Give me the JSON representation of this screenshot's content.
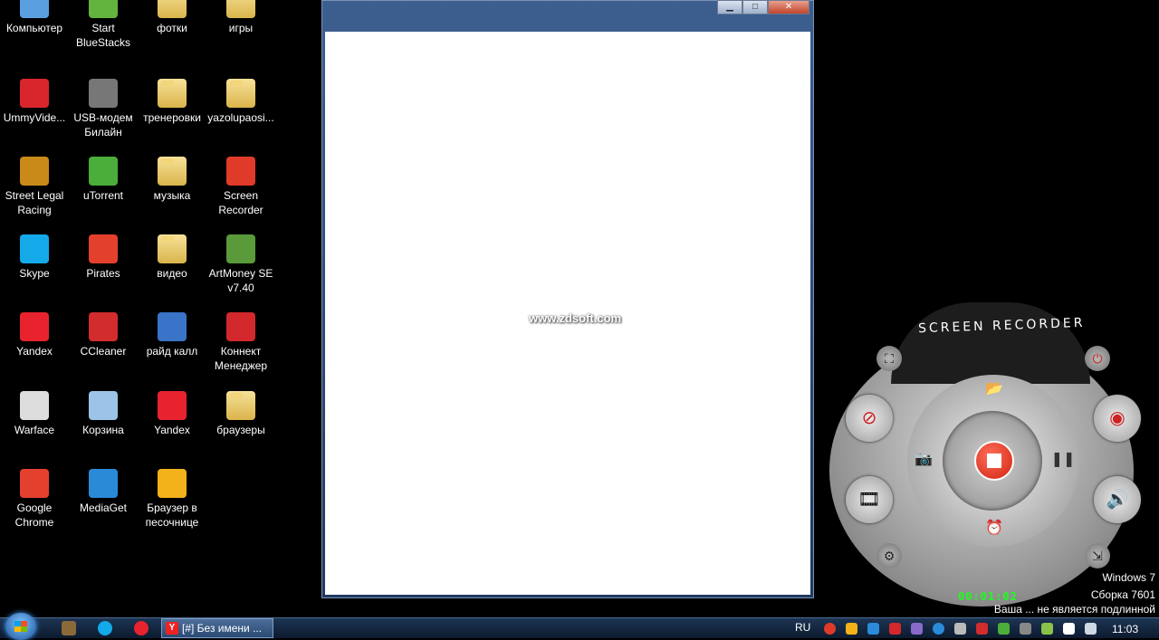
{
  "desktop_icons": [
    {
      "label": "Компьютер",
      "icon": "computer-icon",
      "color": "#5aa0e0"
    },
    {
      "label": "Start\nBlueStacks",
      "icon": "bluestacks-icon",
      "color": "#63b33f"
    },
    {
      "label": "фотки",
      "icon": "folder-icon",
      "color": "#e8c55b"
    },
    {
      "label": "игры",
      "icon": "folder-icon",
      "color": "#e8c55b"
    },
    {
      "label": "UmmyVide...",
      "icon": "ummy-icon",
      "color": "#d9262c"
    },
    {
      "label": "USB-модем\nБилайн",
      "icon": "usb-modem-icon",
      "color": "#777777"
    },
    {
      "label": "тренеровки",
      "icon": "folder-icon",
      "color": "#e8c55b"
    },
    {
      "label": "yazolupaosi...",
      "icon": "folder-icon",
      "color": "#e8c55b"
    },
    {
      "label": "Street Legal\nRacing",
      "icon": "racing-icon",
      "color": "#c98a1a"
    },
    {
      "label": "uTorrent",
      "icon": "utorrent-icon",
      "color": "#4cae3a"
    },
    {
      "label": "музыка",
      "icon": "folder-icon",
      "color": "#e8c55b"
    },
    {
      "label": "Screen\nRecorder",
      "icon": "screen-recorder-icon",
      "color": "#e03a2a"
    },
    {
      "label": "Skype",
      "icon": "skype-icon",
      "color": "#14a9e8"
    },
    {
      "label": "Pirates",
      "icon": "chrome-icon",
      "color": "#e4402e"
    },
    {
      "label": "видео",
      "icon": "folder-icon",
      "color": "#e8c55b"
    },
    {
      "label": "ArtMoney SE\nv7.40",
      "icon": "artmoney-icon",
      "color": "#5a9a3a"
    },
    {
      "label": "Yandex",
      "icon": "yandex-icon",
      "color": "#e8232e"
    },
    {
      "label": "CCleaner",
      "icon": "ccleaner-icon",
      "color": "#d22c2c"
    },
    {
      "label": "райд калл",
      "icon": "raidcall-icon",
      "color": "#3a74c8"
    },
    {
      "label": "Коннект\nМенеджер",
      "icon": "connect-manager-icon",
      "color": "#d3282c"
    },
    {
      "label": "Warface",
      "icon": "warface-icon",
      "color": "#dddddd"
    },
    {
      "label": "Корзина",
      "icon": "recycle-bin-icon",
      "color": "#9cc4e8"
    },
    {
      "label": "Yandex",
      "icon": "yandex-icon",
      "color": "#e8232e"
    },
    {
      "label": "браузеры",
      "icon": "folder-icon",
      "color": "#e8c55b"
    },
    {
      "label": "Google\nChrome",
      "icon": "chrome-icon",
      "color": "#e4402e"
    },
    {
      "label": "MediaGet",
      "icon": "mediaget-icon",
      "color": "#2a8ad8"
    },
    {
      "label": "Браузер в\nпесочнице",
      "icon": "sandbox-browser-icon",
      "color": "#f3b21a"
    }
  ],
  "window": {
    "minimize": "▁",
    "maximize": "□",
    "close": "✕"
  },
  "watermark": "www.zdsoft.com",
  "recorder": {
    "title": "SCREEN RECORDER",
    "timer": "00:01:02"
  },
  "os_notice": {
    "line1": "Windows 7",
    "line2": "Сборка 7601",
    "line3": "Ваша ... не является подлинной"
  },
  "taskbar": {
    "task_label": "[#] Без имени ...",
    "language": "RU",
    "clock": "11:03"
  },
  "colors": {
    "taskbar": "#14263f",
    "timer": "#1aff1a",
    "record_red": "#d0230f"
  }
}
